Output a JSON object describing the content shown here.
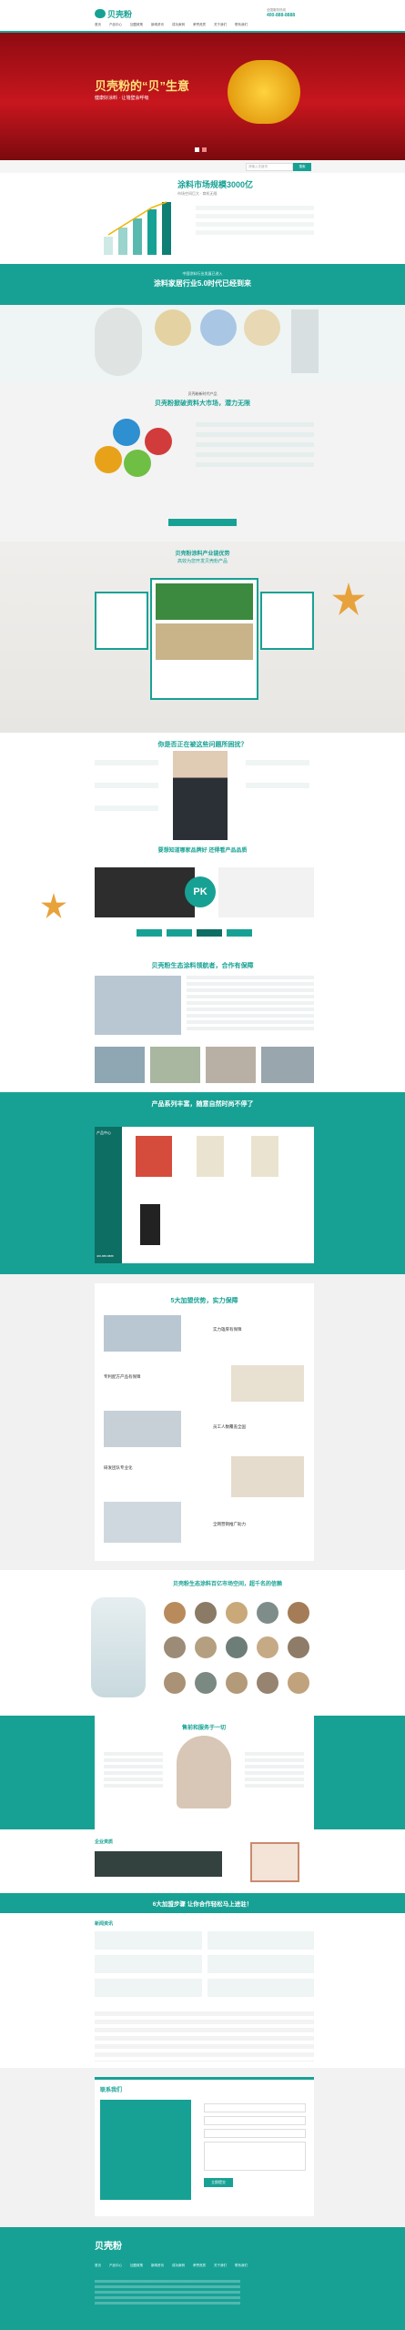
{
  "header": {
    "logo_text": "贝壳粉",
    "phone_label": "全国服务热线",
    "phone": "400-888-8888",
    "nav": [
      "首页",
      "产品中心",
      "加盟政策",
      "新闻资讯",
      "成功案例",
      "荣誉资质",
      "关于我们",
      "联系我们"
    ]
  },
  "hero": {
    "tagline": "贝壳粉的“贝”生意",
    "sub": "健康好涂料 · 让墙壁会呼吸"
  },
  "search": {
    "placeholder": "请输入关键词",
    "button": "搜索"
  },
  "market": {
    "title": "涂料市场规模3000亿",
    "subtitle": "市场空间巨大 · 商机无限"
  },
  "era": {
    "line1": "中国涂料行业发展已进入",
    "line2": "涂料家居行业5.0时代已经到来"
  },
  "cycle": {
    "line1": "贝壳粉新时代产品",
    "line2": "贝壳粉掀破资料大市场，潜力无限"
  },
  "strength": {
    "line1": "贝壳粉涂料产业链优势",
    "line2": "高效为您开发贝壳粉产品"
  },
  "problems": {
    "title": "你是否正在被这些问题所困扰？"
  },
  "pk": {
    "title": "要想知道哪家品牌好 还得看产品品质",
    "badge": "PK"
  },
  "factory": {
    "title": "贝壳粉生态涂料领航者，合作有保障"
  },
  "products": {
    "title": "产品系列丰富，随意自然时尚不停了",
    "menu_title": "产品中心",
    "hotline": "400-888-8888"
  },
  "advantages": {
    "title": "5大加盟优势，实力保障",
    "items": [
      "实力雄厚有保障",
      "专利配方产品有保障",
      "员工人数覆盖全国",
      "研发团队专业化",
      "全网营销推广助力"
    ]
  },
  "cases": {
    "title": "贝壳粉生态涂料百亿市场空间，超千名的信赖"
  },
  "service": {
    "title": "售前和服务于一切"
  },
  "honor": {
    "title": "企业资质"
  },
  "steps": {
    "title": "6大加盟步骤 让你合作轻松马上进驻！"
  },
  "news": {
    "title": "新闻资讯"
  },
  "contact": {
    "title": "联系我们",
    "submit": "立即提交"
  },
  "footer": {
    "logo_text": "贝壳粉",
    "links": [
      "首页",
      "产品中心",
      "加盟政策",
      "新闻资讯",
      "成功案例",
      "荣誉资质",
      "关于我们",
      "联系我们"
    ]
  },
  "colors": {
    "primary": "#17a194",
    "hero_bg": "#b3121a",
    "light": "#e6f2f1"
  }
}
